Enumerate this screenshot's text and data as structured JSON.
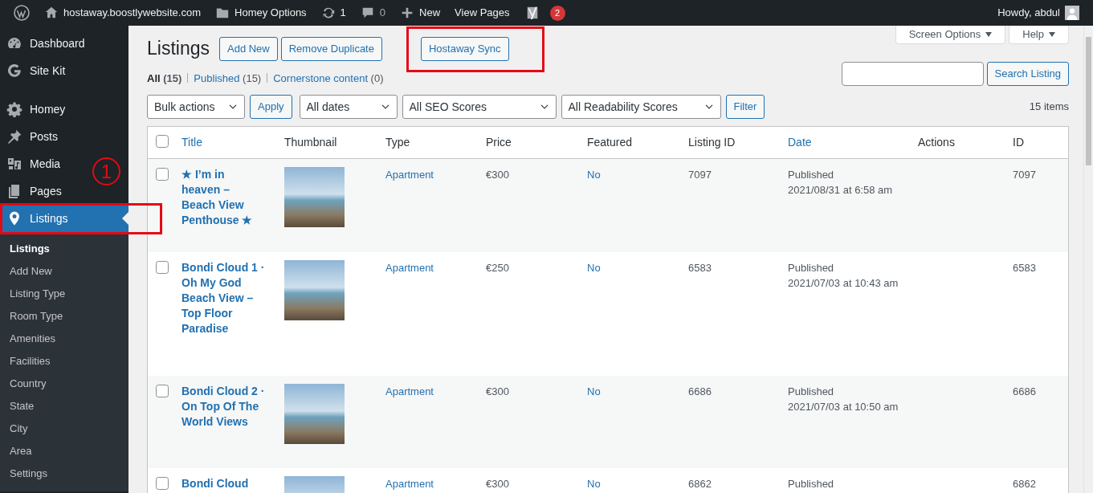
{
  "admin_bar": {
    "site": "hostaway.boostlywebsite.com",
    "items": [
      {
        "kind": "folder",
        "label": "Homey Options"
      },
      {
        "kind": "updates",
        "label": "1"
      },
      {
        "kind": "comments",
        "label": "0"
      },
      {
        "kind": "new",
        "label": "New"
      },
      {
        "kind": "plain",
        "label": "View Pages"
      },
      {
        "kind": "yoast",
        "badge": "2"
      }
    ],
    "greeting": "Howdy, abdul"
  },
  "sidebar": {
    "groups": [
      [
        {
          "label": "Dashboard",
          "selected": false,
          "highlighted": false
        },
        {
          "label": "Site Kit",
          "selected": false,
          "highlighted": false
        }
      ],
      [
        {
          "label": "Homey",
          "selected": false,
          "highlighted": false
        },
        {
          "label": "Posts",
          "selected": false,
          "highlighted": false
        },
        {
          "label": "Media",
          "selected": false,
          "highlighted": false
        },
        {
          "label": "Pages",
          "selected": false,
          "highlighted": false
        },
        {
          "label": "Listings",
          "selected": true,
          "highlighted": true
        }
      ]
    ],
    "submenu": [
      {
        "label": "Listings",
        "selected": true
      },
      {
        "label": "Add New",
        "selected": false
      },
      {
        "label": "Listing Type",
        "selected": false
      },
      {
        "label": "Room Type",
        "selected": false
      },
      {
        "label": "Amenities",
        "selected": false
      },
      {
        "label": "Facilities",
        "selected": false
      },
      {
        "label": "Country",
        "selected": false
      },
      {
        "label": "State",
        "selected": false
      },
      {
        "label": "City",
        "selected": false
      },
      {
        "label": "Area",
        "selected": false
      },
      {
        "label": "Settings",
        "selected": false
      }
    ],
    "marker": "1"
  },
  "page": {
    "title": "Listings",
    "actions": [
      {
        "label": "Add New",
        "highlighted": false
      },
      {
        "label": "Remove Duplicate",
        "highlighted": false
      },
      {
        "label": "Hostaway Sync",
        "highlighted": true
      }
    ],
    "screen_options": "Screen Options",
    "help": "Help",
    "views": [
      {
        "label": "All",
        "count": "(15)",
        "selected": true
      },
      {
        "label": "Published",
        "count": "(15)",
        "selected": false
      },
      {
        "label": "Cornerstone content",
        "count": "(0)",
        "selected": false
      }
    ],
    "search_button": "Search Listing",
    "bulk_action": "Bulk actions",
    "apply": "Apply",
    "dropdowns": [
      "All dates",
      "All SEO Scores",
      "All Readability Scores"
    ],
    "filter": "Filter",
    "items_count": "15 items"
  },
  "table": {
    "select_all": false,
    "columns": [
      {
        "label": "Title",
        "sortable": true
      },
      {
        "label": "Thumbnail",
        "sortable": false
      },
      {
        "label": "Type",
        "sortable": false
      },
      {
        "label": "Price",
        "sortable": false
      },
      {
        "label": "Featured",
        "sortable": false
      },
      {
        "label": "Listing ID",
        "sortable": false
      },
      {
        "label": "Date",
        "sortable": true
      },
      {
        "label": "Actions",
        "sortable": false
      },
      {
        "label": "ID",
        "sortable": false
      }
    ],
    "rows": [
      {
        "selected": false,
        "title": "★ I’m in heaven – Beach View Penthouse ★",
        "type": "Apartment",
        "price": "€300",
        "featured": "No",
        "listing_id": "7097",
        "status": "Published",
        "date": "2021/08/31 at 6:58 am",
        "id": "7097"
      },
      {
        "selected": false,
        "title": "Bondi Cloud 1 · Oh My God Beach View – Top Floor Paradise",
        "type": "Apartment",
        "price": "€250",
        "featured": "No",
        "listing_id": "6583",
        "status": "Published",
        "date": "2021/07/03 at 10:43 am",
        "id": "6583"
      },
      {
        "selected": false,
        "title": "Bondi Cloud 2 · On Top Of The World Views",
        "type": "Apartment",
        "price": "€300",
        "featured": "No",
        "listing_id": "6686",
        "status": "Published",
        "date": "2021/07/03 at 10:50 am",
        "id": "6686"
      },
      {
        "selected": false,
        "title": "Bondi Cloud",
        "type": "Apartment",
        "price": "€300",
        "featured": "No",
        "listing_id": "6862",
        "status": "Published",
        "id": "6862"
      }
    ]
  }
}
